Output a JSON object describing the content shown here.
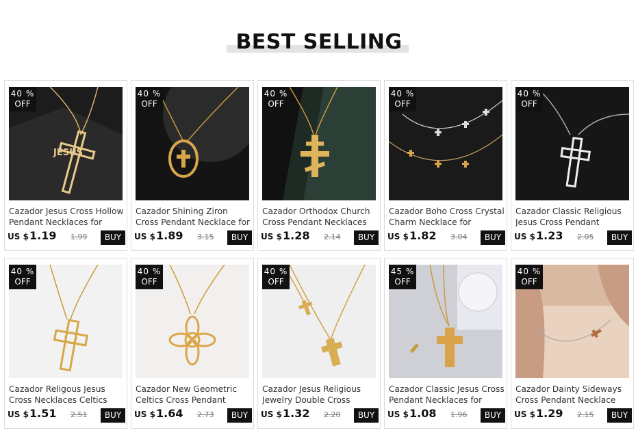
{
  "section": {
    "title": "BEST SELLING"
  },
  "products": [
    {
      "badge_pct": "40 %",
      "badge_off": "OFF",
      "name": "Cazador Jesus Cross Hollow Pendant Necklaces for",
      "currency": "US $",
      "price": "1.19",
      "old_price": "1.99",
      "buy_label": "BUY",
      "photo": "jesus-cross-necklace"
    },
    {
      "badge_pct": "40 %",
      "badge_off": "OFF",
      "name": "Cazador Shining Ziron Cross Pendant Necklace for",
      "currency": "US $",
      "price": "1.89",
      "old_price": "3.15",
      "buy_label": "BUY",
      "photo": "oval-cross-necklace"
    },
    {
      "badge_pct": "40 %",
      "badge_off": "OFF",
      "name": "Cazador Orthodox Church Cross Pendant Necklaces",
      "currency": "US $",
      "price": "1.28",
      "old_price": "2.14",
      "buy_label": "BUY",
      "photo": "orthodox-cross-necklace"
    },
    {
      "badge_pct": "40 %",
      "badge_off": "OFF",
      "name": "Cazador Boho Cross Crystal Charm Necklace for Women",
      "currency": "US $",
      "price": "1.82",
      "old_price": "3.04",
      "buy_label": "BUY",
      "photo": "boho-cross-necklace"
    },
    {
      "badge_pct": "40 %",
      "badge_off": "OFF",
      "name": "Cazador Classic Religious Jesus Cross Pendant",
      "currency": "US $",
      "price": "1.23",
      "old_price": "2.05",
      "buy_label": "BUY",
      "photo": "silver-cross-necklace"
    },
    {
      "badge_pct": "40 %",
      "badge_off": "OFF",
      "name": "Cazador Religous Jesus Cross Necklaces Celtics Knot",
      "currency": "US $",
      "price": "1.51",
      "old_price": "2.51",
      "buy_label": "BUY",
      "photo": "celtic-cross-necklace"
    },
    {
      "badge_pct": "40 %",
      "badge_off": "OFF",
      "name": "Cazador New Geometric Celtics Cross Pendant",
      "currency": "US $",
      "price": "1.64",
      "old_price": "2.73",
      "buy_label": "BUY",
      "photo": "knot-cross-necklace"
    },
    {
      "badge_pct": "40 %",
      "badge_off": "OFF",
      "name": "Cazador Jesus Religious Jewelry Double Cross",
      "currency": "US $",
      "price": "1.32",
      "old_price": "2.20",
      "buy_label": "BUY",
      "photo": "double-cross-necklace"
    },
    {
      "badge_pct": "45 %",
      "badge_off": "OFF",
      "name": "Cazador Classic Jesus Cross Pendant Necklaces for",
      "currency": "US $",
      "price": "1.08",
      "old_price": "1.96",
      "buy_label": "BUY",
      "photo": "classic-cross-necklace"
    },
    {
      "badge_pct": "40 %",
      "badge_off": "OFF",
      "name": "Cazador Dainty Sideways Cross Pendant Necklace",
      "currency": "US $",
      "price": "1.29",
      "old_price": "2.15",
      "buy_label": "BUY",
      "photo": "sideways-cross-necklace"
    }
  ],
  "colors": {
    "badge_bg": "#111111",
    "buy_bg": "#111111",
    "border": "#dcdcdc",
    "title_bar": "#e3e3e3"
  }
}
